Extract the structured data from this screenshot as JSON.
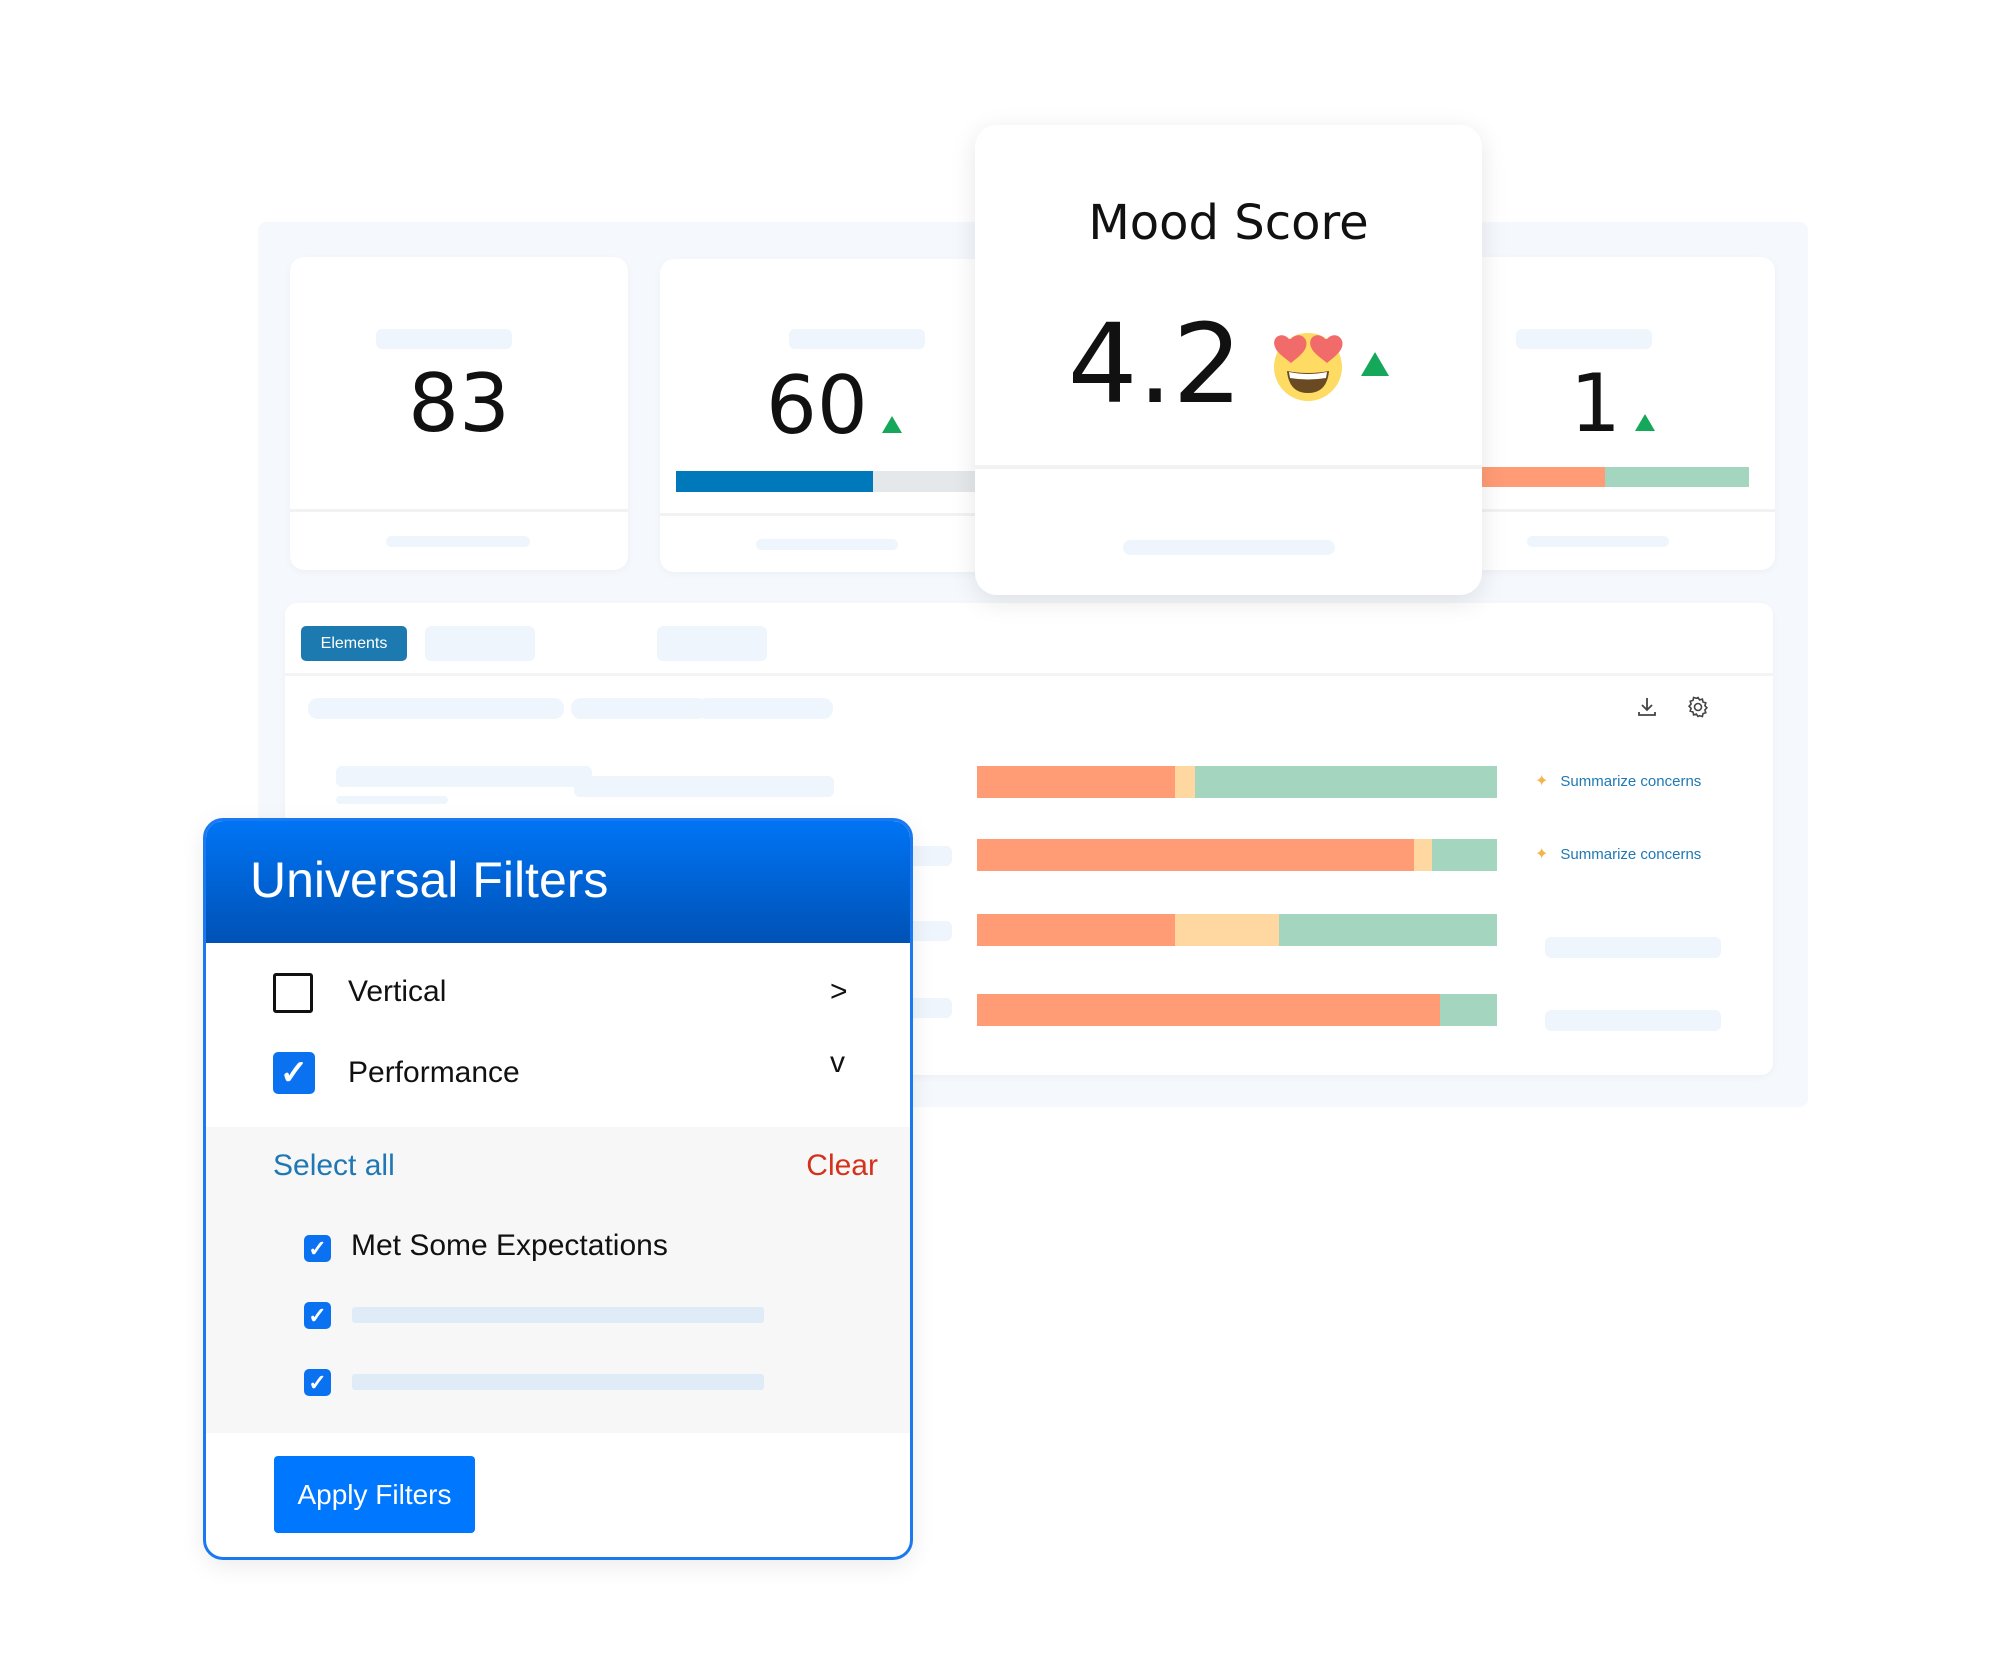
{
  "kpi_cards": [
    {
      "value": "83",
      "trend": null
    },
    {
      "value": "60",
      "trend": "up",
      "progress_percent": 58
    },
    {
      "value": "1",
      "trend": "up",
      "split": {
        "negative_percent": 47,
        "positive_percent": 53
      }
    }
  ],
  "mood_card": {
    "title": "Mood Score",
    "value": "4.2",
    "emoji": "heart-eyes-face",
    "trend": "up"
  },
  "table": {
    "tabs": [
      {
        "label": "Elements",
        "active": true
      }
    ],
    "toolbar_icons": [
      "download-icon",
      "gear-icon"
    ],
    "rows": [
      {
        "sentiment": {
          "negative": 38,
          "neutral": 4,
          "positive": 58
        },
        "action": "Summarize concerns"
      },
      {
        "sentiment": {
          "negative": 84,
          "neutral": 3.5,
          "positive": 12.5
        },
        "action": "Summarize concerns"
      },
      {
        "sentiment": {
          "negative": 38,
          "neutral": 20,
          "positive": 42
        },
        "action": null
      },
      {
        "sentiment": {
          "negative": 89,
          "neutral": 0,
          "positive": 11
        },
        "action": null
      }
    ]
  },
  "filters": {
    "title": "Universal Filters",
    "groups": [
      {
        "label": "Vertical",
        "checked": false,
        "chevron": ">"
      },
      {
        "label": "Performance",
        "checked": true,
        "chevron": "v"
      }
    ],
    "select_all": "Select all",
    "clear": "Clear",
    "options": [
      {
        "label": "Met Some Expectations",
        "checked": true
      },
      {
        "label": "",
        "checked": true
      },
      {
        "label": "",
        "checked": true
      }
    ],
    "apply_label": "Apply Filters"
  },
  "colors": {
    "negative": "#ff9c76",
    "neutral": "#fed8a0",
    "positive": "#a4d5be",
    "accent": "#0077ff",
    "trend_up": "#16a85a",
    "clear": "#d4321c",
    "link": "#1f78b4"
  }
}
